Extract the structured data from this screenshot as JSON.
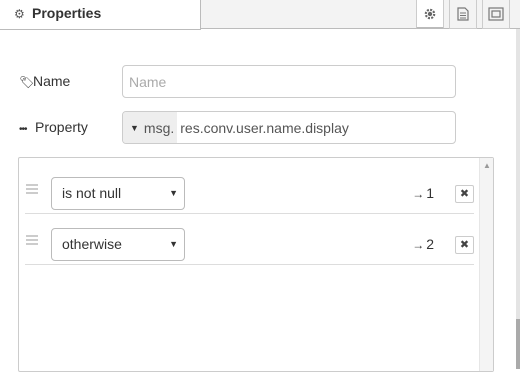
{
  "tabs": {
    "active_label": "Properties",
    "icons": [
      "gear-icon",
      "document-icon",
      "frame-icon"
    ]
  },
  "form": {
    "name": {
      "label": "Name",
      "value": "",
      "placeholder": "Name"
    },
    "property": {
      "label": "Property",
      "type_prefix": "msg.",
      "value": "res.conv.user.name.display"
    }
  },
  "rules": [
    {
      "operator": "is not null",
      "output": "1"
    },
    {
      "operator": "otherwise",
      "output": "2"
    }
  ],
  "ui": {
    "arrow": "→",
    "remove": "✖"
  }
}
